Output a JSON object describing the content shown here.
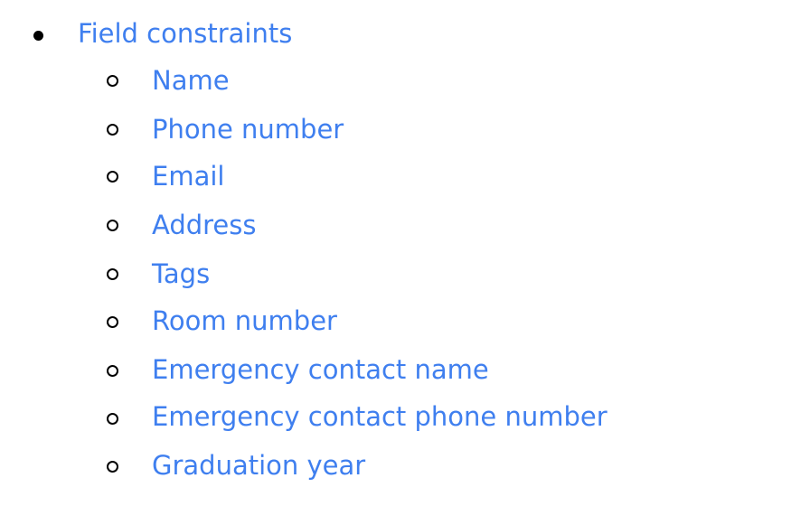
{
  "colors": {
    "link": "#3f7fef",
    "bullet": "#000000",
    "background": "#ffffff"
  },
  "toc": {
    "top_item": {
      "label": "Field constraints"
    },
    "sub_items": [
      {
        "label": "Name"
      },
      {
        "label": "Phone number"
      },
      {
        "label": "Email"
      },
      {
        "label": "Address"
      },
      {
        "label": "Tags"
      },
      {
        "label": "Room number"
      },
      {
        "label": "Emergency contact name"
      },
      {
        "label": "Emergency contact phone number"
      },
      {
        "label": "Graduation year"
      }
    ]
  }
}
